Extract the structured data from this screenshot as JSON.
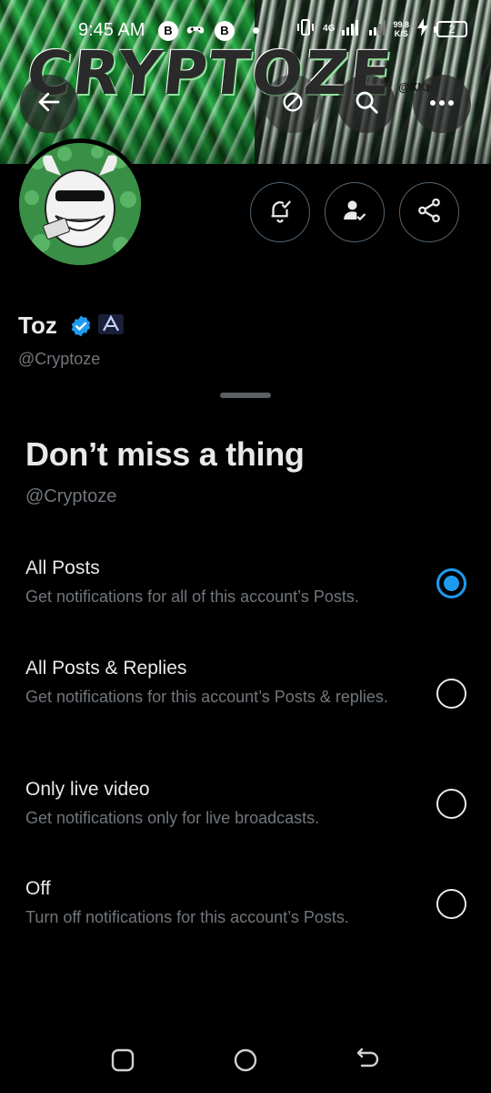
{
  "banner": {
    "title": "CRYPTOZE",
    "badges": "@XK▶"
  },
  "status_bar": {
    "time": "9:45 AM",
    "icon1": "B",
    "icon2": "B",
    "network": "4G",
    "speed_value": "99.8",
    "speed_unit": "K/S",
    "battery": "2"
  },
  "profile": {
    "name": "Toz",
    "handle": "@Cryptoze"
  },
  "sheet": {
    "title": "Don’t miss a thing",
    "handle": "@Cryptoze",
    "options": [
      {
        "title": "All Posts",
        "description": "Get notifications for all of this account’s Posts.",
        "selected": true
      },
      {
        "title": "All Posts & Replies",
        "description": "Get notifications for this account’s Posts & replies.",
        "selected": false
      },
      {
        "title": "Only live video",
        "description": "Get notifications only for live broadcasts.",
        "selected": false
      },
      {
        "title": "Off",
        "description": "Turn off notifications for this account’s Posts.",
        "selected": false
      }
    ]
  },
  "colors": {
    "accent": "#1d9bf0",
    "background": "#000000",
    "secondary_text": "#71767b",
    "primary_text": "#e7e9ea"
  },
  "icons": [
    "back-arrow-icon",
    "search-icon",
    "more-icon",
    "bell-notification-icon",
    "person-check-icon",
    "share-icon",
    "verified-badge-icon"
  ]
}
